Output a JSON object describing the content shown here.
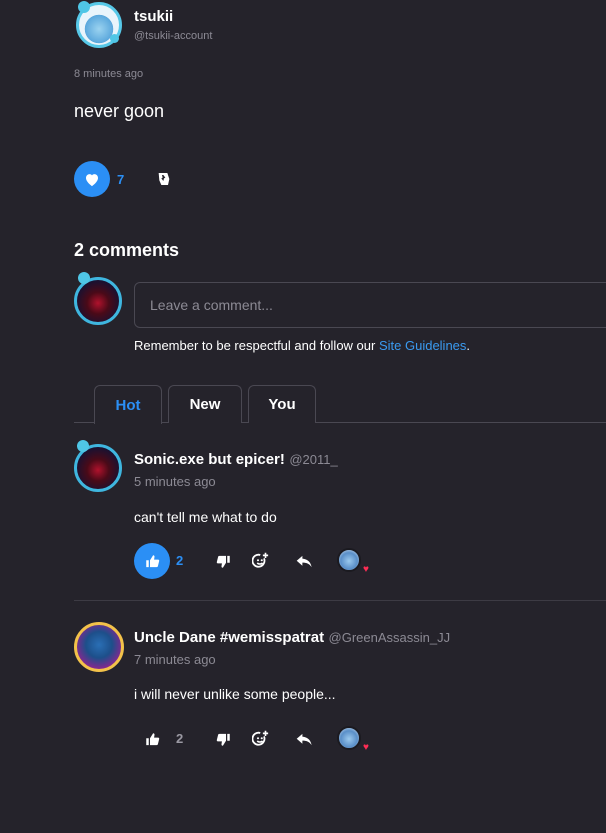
{
  "post": {
    "author_name": "tsukii",
    "author_handle": "@tsukii-account",
    "time": "8 minutes ago",
    "text": "never goon",
    "like_count": "7"
  },
  "comments_section": {
    "title": "2 comments",
    "input_placeholder": "Leave a comment...",
    "guidelines_prefix": "Remember to be respectful and follow our ",
    "guidelines_link": "Site Guidelines",
    "guidelines_suffix": "."
  },
  "tabs": [
    {
      "label": "Hot",
      "active": true
    },
    {
      "label": "New",
      "active": false
    },
    {
      "label": "You",
      "active": false
    }
  ],
  "comments": [
    {
      "author_name": "Sonic.exe but epicer!",
      "author_handle": "@2011_",
      "time": "5 minutes ago",
      "text": "can't tell me what to do",
      "like_count": "2",
      "liked": true
    },
    {
      "author_name": "Uncle Dane #wemisspatrat",
      "author_handle": "@GreenAssassin_JJ",
      "time": "7 minutes ago",
      "text": "i will never unlike some people...",
      "like_count": "2",
      "liked": false
    }
  ],
  "colors": {
    "accent": "#2b8ff5",
    "background": "#25232b",
    "heart": "#ff2d55"
  },
  "icons": [
    "heart-icon",
    "thumbs-down-icon",
    "thumbs-up-icon",
    "add-reaction-icon",
    "reply-icon"
  ]
}
